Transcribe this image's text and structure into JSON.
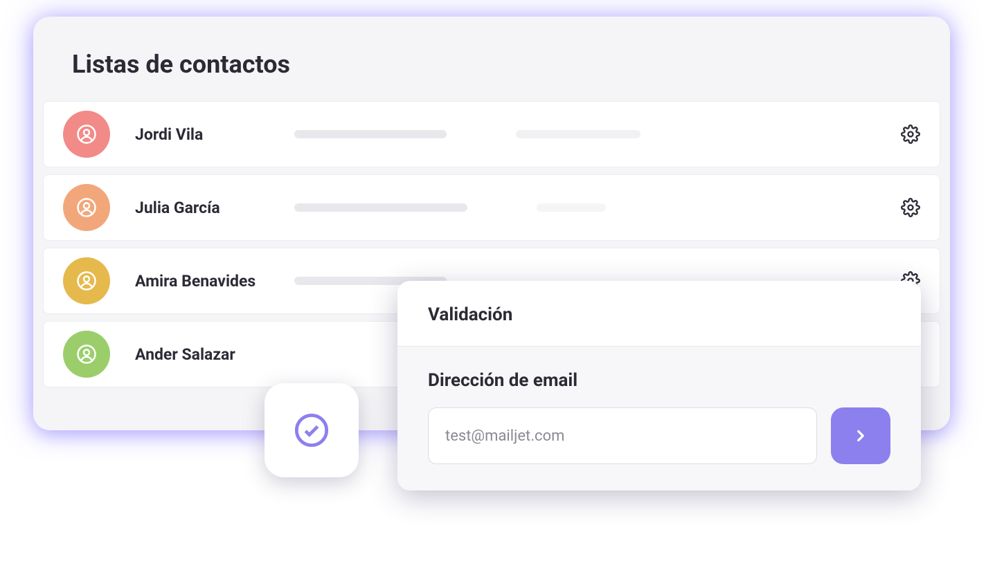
{
  "page_title": "Listas de contactos",
  "contacts": [
    {
      "name": "Jordi Vila",
      "avatar_color": "#f28a87"
    },
    {
      "name": "Julia García",
      "avatar_color": "#f2a77a"
    },
    {
      "name": "Amira Benavides",
      "avatar_color": "#e6b94d"
    },
    {
      "name": "Ander Salazar",
      "avatar_color": "#9bce6b"
    }
  ],
  "validation": {
    "header": "Validación",
    "field_label": "Dirección de email",
    "placeholder": "test@mailjet.com"
  },
  "colors": {
    "accent": "#8c7fee",
    "check_ring": "#8c7fee"
  }
}
